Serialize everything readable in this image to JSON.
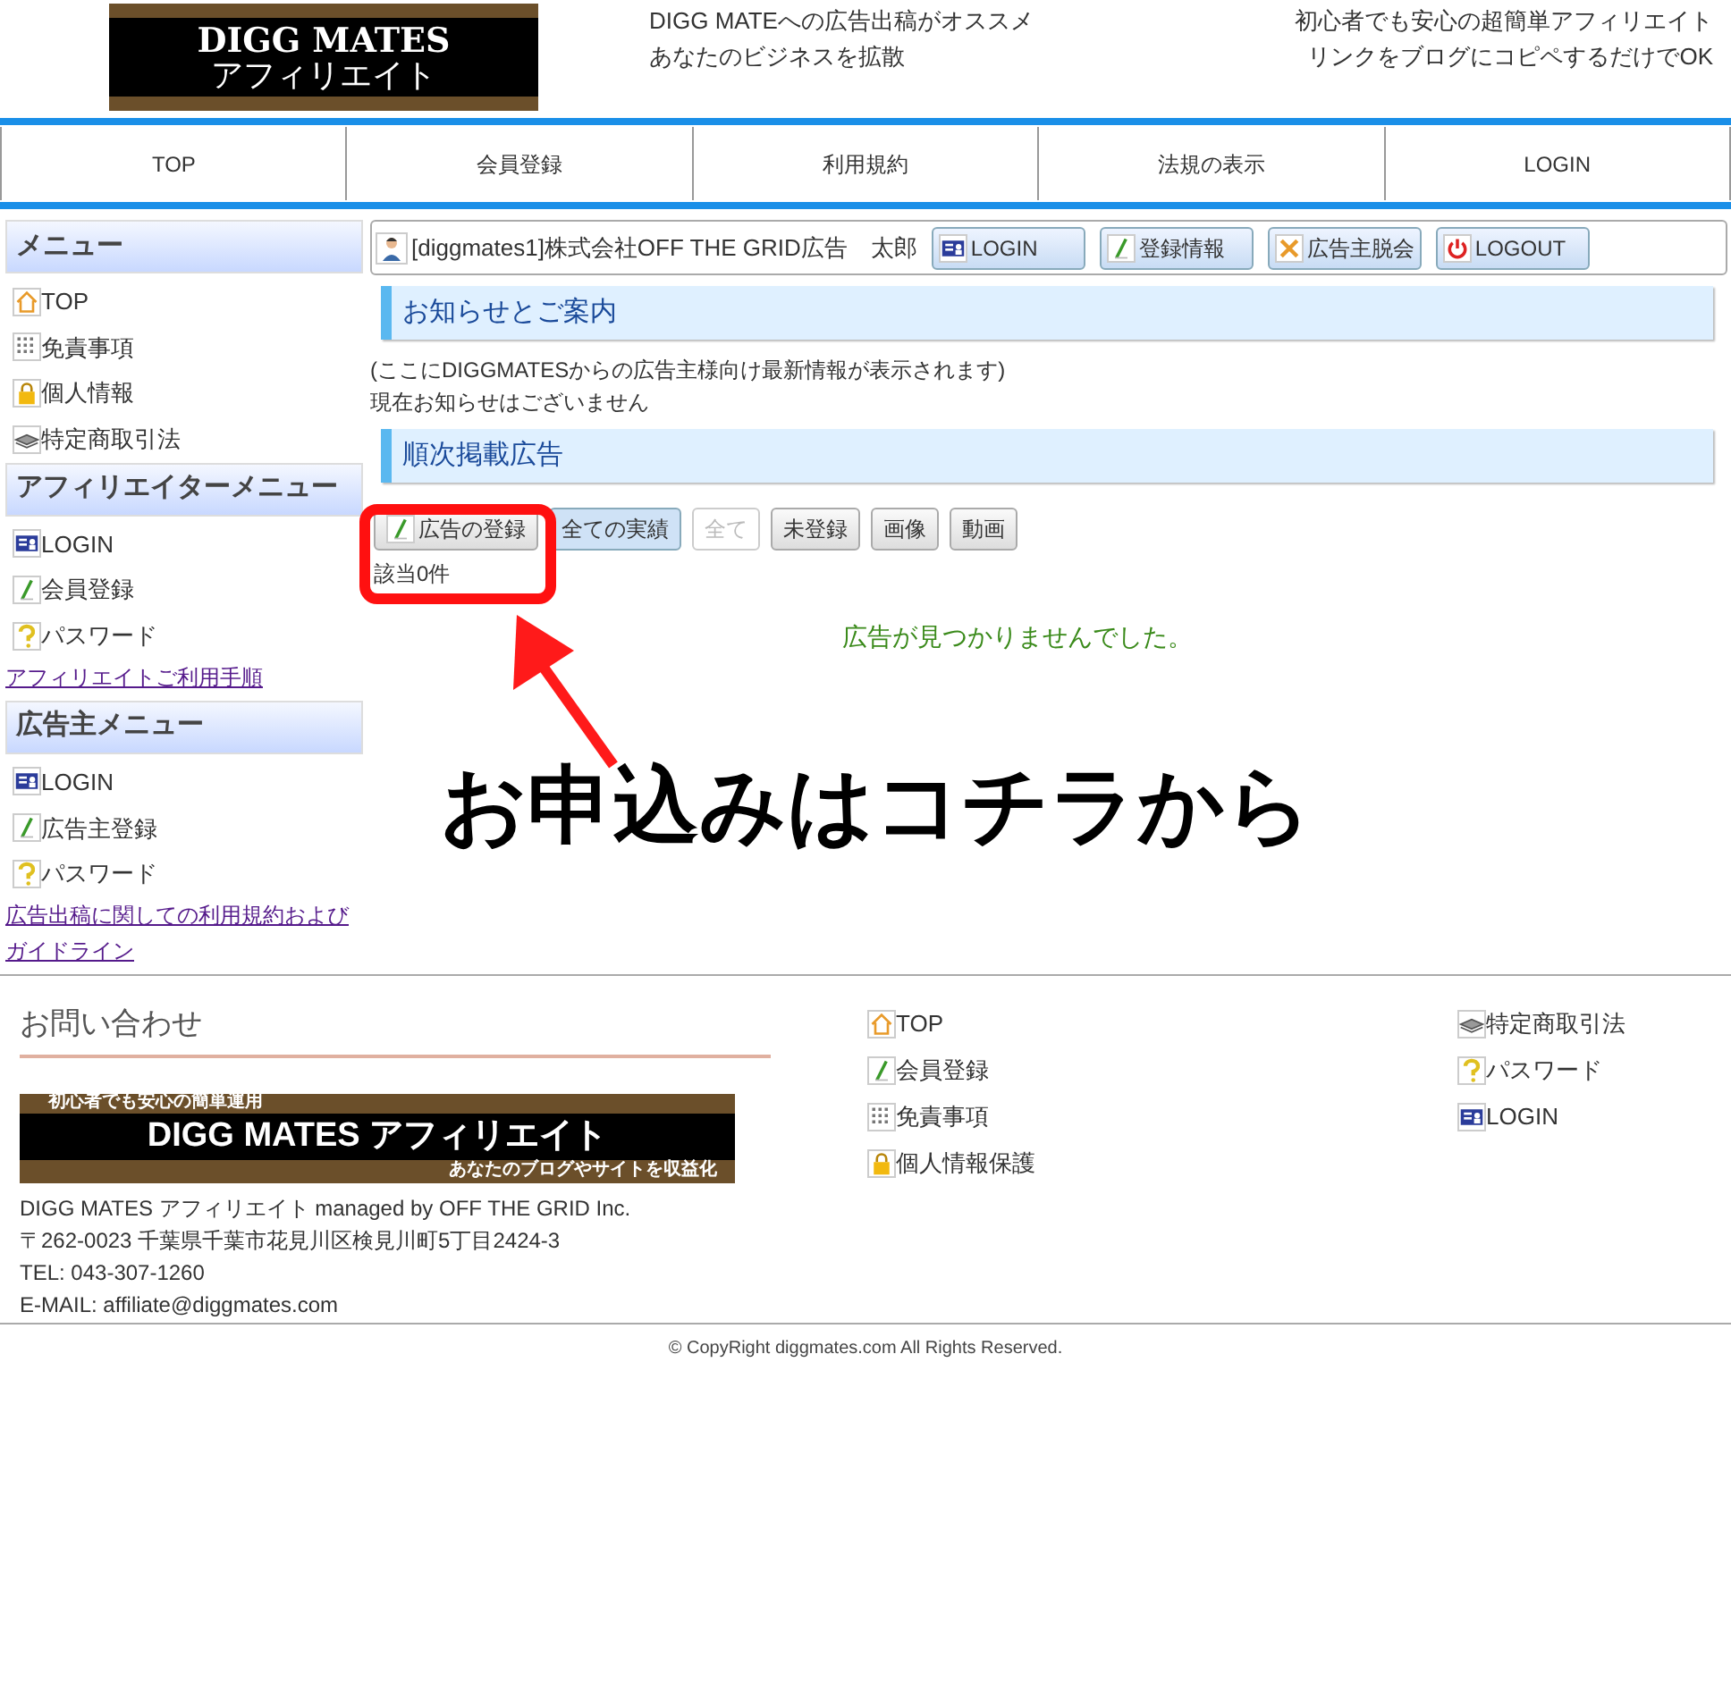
{
  "header": {
    "logo_lines": [
      "DIGG MATES",
      "アフィリエイト"
    ],
    "tagline_left": [
      "DIGG MATEへの広告出稿がオススメ",
      "あなたのビジネスを拡散"
    ],
    "tagline_right": [
      "初心者でも安心の超簡単アフィリエイト",
      "リンクをブログにコピペするだけでOK"
    ]
  },
  "nav": [
    "TOP",
    "会員登録",
    "利用規約",
    "法規の表示",
    "LOGIN"
  ],
  "sidebar": [
    {
      "title": "メニュー",
      "items": [
        {
          "kind": "home",
          "label": "TOP"
        },
        {
          "kind": "grid",
          "label": "免責事項"
        },
        {
          "kind": "lock",
          "label": "個人情報"
        },
        {
          "kind": "layers",
          "label": "特定商取引法"
        }
      ]
    },
    {
      "title": "アフィリエイターメニュー",
      "items": [
        {
          "kind": "card",
          "label": "LOGIN"
        },
        {
          "kind": "pencil",
          "label": "会員登録"
        },
        {
          "kind": "question",
          "label": "パスワード"
        }
      ],
      "link": "アフィリエイトご利用手順"
    },
    {
      "title": "広告主メニュー",
      "items": [
        {
          "kind": "card",
          "label": "LOGIN"
        },
        {
          "kind": "pencil",
          "label": "広告主登録"
        },
        {
          "kind": "question",
          "label": "パスワード"
        }
      ],
      "link": "広告出稿に関しての利用規約およびガイドライン"
    }
  ],
  "user_bar": {
    "user": "[diggmates1]株式会社OFF THE GRID広告　太郎",
    "buttons": [
      {
        "kind": "card",
        "label": "LOGIN"
      },
      {
        "kind": "pencil",
        "label": "登録情報"
      },
      {
        "kind": "cross",
        "label": "広告主脱会"
      },
      {
        "kind": "power",
        "label": "LOGOUT"
      }
    ]
  },
  "notice": {
    "heading": "お知らせとご案内",
    "lines": [
      "(ここにDIGGMATESからの広告主様向け最新情報が表示されます)",
      "現在お知らせはございません"
    ]
  },
  "ads": {
    "heading": "順次掲載広告",
    "filters": [
      {
        "kind": "add",
        "label": "広告の登録",
        "disabled": false,
        "selected": false
      },
      {
        "kind": "plain",
        "label": "全ての実績",
        "disabled": false,
        "selected": true
      },
      {
        "kind": "plain",
        "label": "全て",
        "disabled": true,
        "selected": false
      },
      {
        "kind": "plain",
        "label": "未登録",
        "disabled": false,
        "selected": false
      },
      {
        "kind": "plain",
        "label": "画像",
        "disabled": false,
        "selected": false
      },
      {
        "kind": "plain",
        "label": "動画",
        "disabled": false,
        "selected": false
      }
    ],
    "count": "該当0件",
    "empty_message": "広告が見つかりませんでした。"
  },
  "annotation": {
    "callout": "お申込みはコチラから"
  },
  "footer": {
    "contact_title": "お問い合わせ",
    "banner": {
      "top": "初心者でも安心の簡単運用",
      "main": "DIGG MATES アフィリエイト",
      "bottom": "あなたのブログやサイトを収益化"
    },
    "address_lines": [
      "DIGG MATES アフィリエイト managed by OFF THE GRID Inc.",
      "〒262-0023 千葉県千葉市花見川区検見川町5丁目2424-3",
      "TEL: 043-307-1260",
      "E-MAIL: affiliate@diggmates.com"
    ],
    "links_col_1": [
      {
        "kind": "home",
        "label": "TOP"
      },
      {
        "kind": "pencil",
        "label": "会員登録"
      },
      {
        "kind": "grid",
        "label": "免責事項"
      },
      {
        "kind": "lock",
        "label": "個人情報保護"
      }
    ],
    "links_col_2": [
      {
        "kind": "layers",
        "label": "特定商取引法"
      },
      {
        "kind": "question",
        "label": "パスワード"
      },
      {
        "kind": "card",
        "label": "LOGIN"
      }
    ],
    "copyright": "© CopyRight diggmates.com All Rights Reserved."
  }
}
